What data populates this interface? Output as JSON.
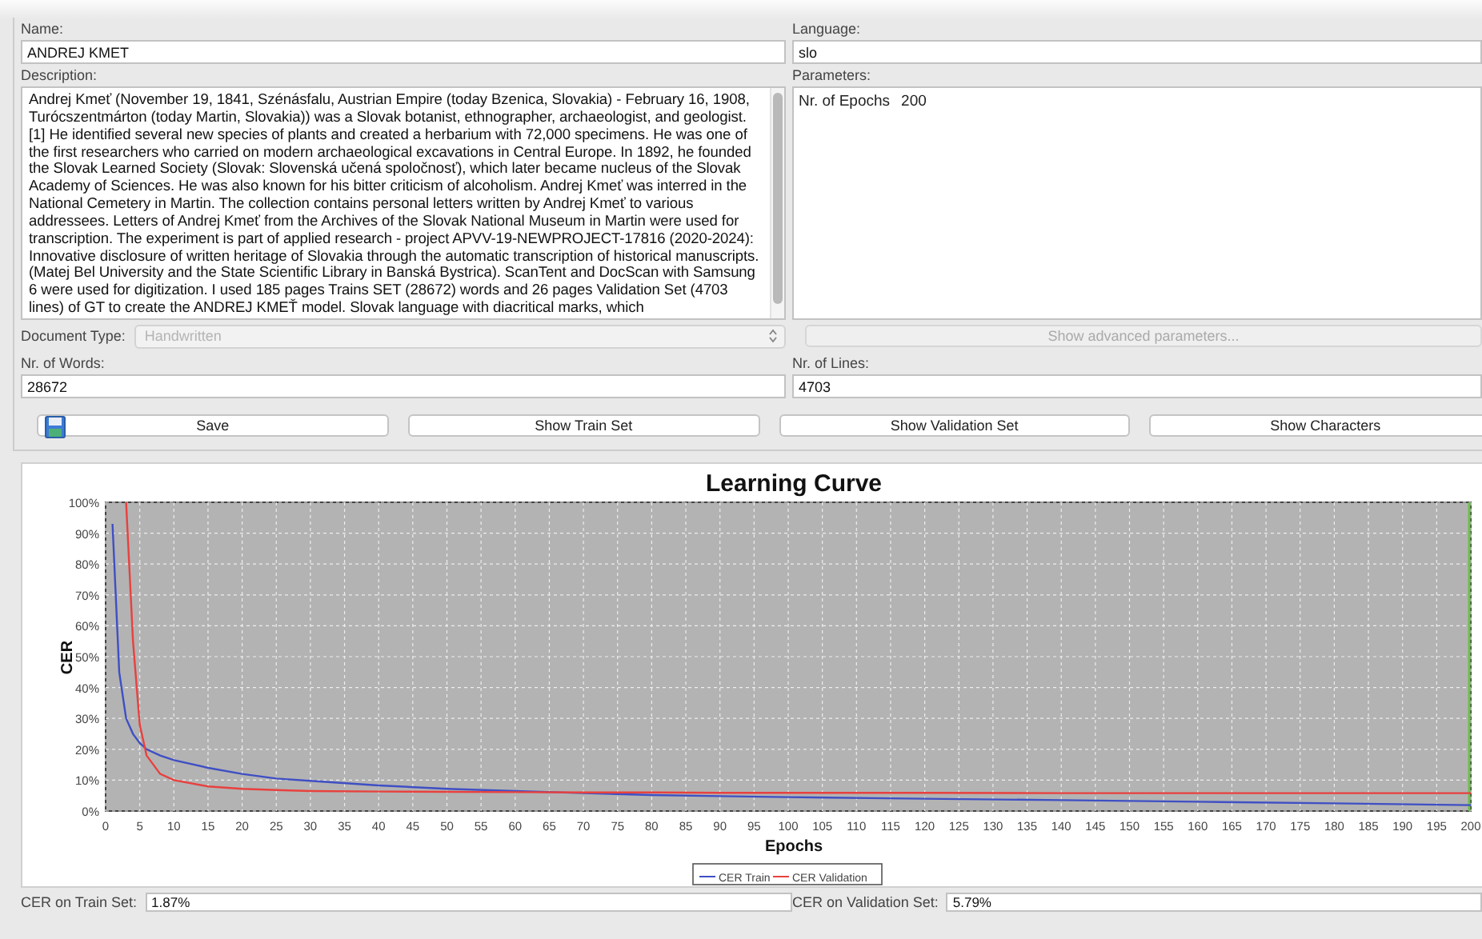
{
  "form": {
    "name": {
      "label": "Name:",
      "value": "ANDREJ KMET"
    },
    "language": {
      "label": "Language:",
      "value": "slo"
    },
    "description": {
      "label": "Description:",
      "value": "Andrej Kmeť (November 19, 1841, Szénásfalu, Austrian Empire (today Bzenica, Slovakia) - February 16, 1908, Turócszentmárton (today Martin, Slovakia)) was a Slovak botanist, ethnographer, archaeologist, and geologist. [1] He identified several new species of plants and created a herbarium with 72,000 specimens. He was one of the first researchers who carried on modern archaeological excavations in Central Europe. In 1892, he founded the Slovak Learned Society (Slovak: Slovenská učená spoločnosť), which later became nucleus of the Slovak Academy of Sciences. He was also known for his bitter criticism of alcoholism. Andrej Kmeť was interred in the National Cemetery in Martin. The collection contains personal letters written by Andrej Kmeť to various addressees. Letters of Andrej Kmeť from the Archives of the Slovak National Museum in Martin were used for transcription. The experiment is part of applied research - project APVV-19-NEWPROJECT-17816 (2020-2024): Innovative disclosure of written heritage of Slovakia through the automatic transcription of historical manuscripts. (Matej Bel University and the State Scientific Library in Banská Bystrica). ScanTent and DocScan with Samsung 6 were used for digitization. I used 185 pages Trains SET (28672) words and 26 pages Validation Set (4703 lines) of GT to create the ANDREJ KMEŤ model. Slovak language with diacritical marks, which"
    },
    "parameters": {
      "label": "Parameters:",
      "items": [
        {
          "name": "Nr. of Epochs",
          "value": "200"
        }
      ]
    },
    "document_type": {
      "label": "Document Type:",
      "value": "Handwritten",
      "disabled": true
    },
    "advanced_button": {
      "label": "Show advanced parameters...",
      "disabled": true
    },
    "words": {
      "label": "Nr. of Words:",
      "value": "28672"
    },
    "lines": {
      "label": "Nr. of Lines:",
      "value": "4703"
    }
  },
  "buttons": [
    {
      "label": "Save",
      "kind": "save"
    },
    {
      "label": "Show Train Set",
      "kind": "plain"
    },
    {
      "label": "Show Validation Set",
      "kind": "plain"
    },
    {
      "label": "Show Characters",
      "kind": "plain"
    }
  ],
  "chart": {
    "chart_data": {
      "type": "line",
      "title": "Learning Curve",
      "xlabel": "Epochs",
      "ylabel": "CER",
      "x": [
        1,
        2,
        3,
        4,
        5,
        6,
        8,
        10,
        15,
        20,
        25,
        30,
        40,
        50,
        60,
        70,
        80,
        90,
        100,
        120,
        140,
        160,
        180,
        200
      ],
      "series": [
        {
          "name": "CER Train",
          "color": "#3f4fc4",
          "values": [
            93,
            45,
            30,
            25,
            22,
            20,
            18,
            16.5,
            14,
            12,
            10.5,
            9.8,
            8.3,
            7.2,
            6.5,
            5.8,
            5.2,
            4.8,
            4.5,
            4,
            3.5,
            3,
            2.5,
            1.9
          ]
        },
        {
          "name": "CER Validation",
          "color": "#e8413e",
          "values": [
            null,
            null,
            100,
            55,
            28,
            18,
            12,
            10,
            8,
            7.2,
            6.8,
            6.5,
            6.3,
            6.2,
            6.1,
            6,
            6,
            5.9,
            5.9,
            5.9,
            5.8,
            5.8,
            5.8,
            5.8
          ]
        }
      ],
      "xlim": [
        0,
        200
      ],
      "ylim": [
        0,
        100
      ],
      "grid": true,
      "legend": true,
      "xticks": [
        0,
        5,
        10,
        15,
        20,
        25,
        30,
        35,
        40,
        45,
        50,
        55,
        60,
        65,
        70,
        75,
        80,
        85,
        90,
        95,
        100,
        105,
        110,
        115,
        120,
        125,
        130,
        135,
        140,
        145,
        150,
        155,
        160,
        165,
        170,
        175,
        180,
        185,
        190,
        195,
        200
      ],
      "yticks": [
        {
          "value": 0,
          "label": "0%"
        },
        {
          "value": 10,
          "label": "10%"
        },
        {
          "value": 20,
          "label": "20%"
        },
        {
          "value": 30,
          "label": "30%"
        },
        {
          "value": 40,
          "label": "40%"
        },
        {
          "value": 50,
          "label": "50%"
        },
        {
          "value": 60,
          "label": "60%"
        },
        {
          "value": 70,
          "label": "70%"
        },
        {
          "value": 80,
          "label": "80%"
        },
        {
          "value": 90,
          "label": "90%"
        },
        {
          "value": 100,
          "label": "100%"
        }
      ]
    }
  },
  "results": [
    {
      "label": "CER on Train Set:",
      "value": "1.87%"
    },
    {
      "label": "CER on Validation Set:",
      "value": "5.79%"
    }
  ]
}
